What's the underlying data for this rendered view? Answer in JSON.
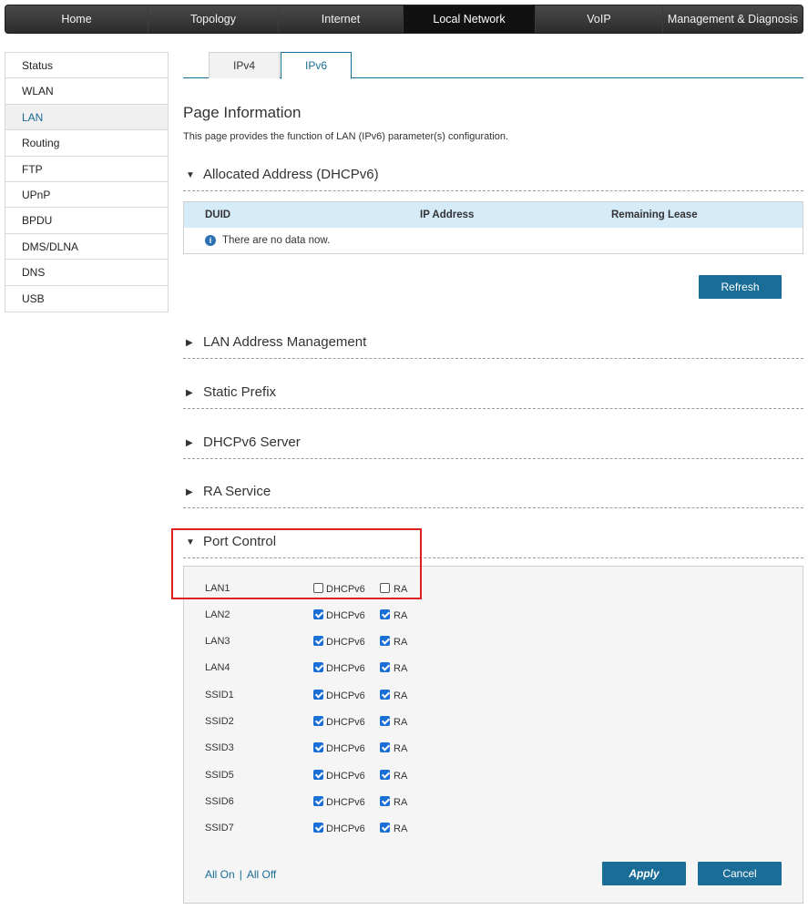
{
  "topnav": {
    "items": [
      {
        "label": "Home"
      },
      {
        "label": "Topology"
      },
      {
        "label": "Internet"
      },
      {
        "label": "Local Network"
      },
      {
        "label": "VoIP"
      },
      {
        "label": "Management & Diagnosis"
      }
    ],
    "active": "Local Network"
  },
  "sidebar": {
    "items": [
      {
        "label": "Status"
      },
      {
        "label": "WLAN"
      },
      {
        "label": "LAN"
      },
      {
        "label": "Routing"
      },
      {
        "label": "FTP"
      },
      {
        "label": "UPnP"
      },
      {
        "label": "BPDU"
      },
      {
        "label": "DMS/DLNA"
      },
      {
        "label": "DNS"
      },
      {
        "label": "USB"
      }
    ],
    "active": "LAN"
  },
  "tabs": [
    {
      "label": "IPv4"
    },
    {
      "label": "IPv6"
    }
  ],
  "active_tab": "IPv6",
  "page": {
    "title": "Page Information",
    "description": "This page provides the function of LAN (IPv6) parameter(s) configuration."
  },
  "sections": {
    "allocated": "Allocated Address (DHCPv6)",
    "lan_addr": "LAN Address Management",
    "static_prefix": "Static Prefix",
    "dhcpv6_server": "DHCPv6 Server",
    "ra_service": "RA Service",
    "port_control": "Port Control"
  },
  "allocated_table": {
    "columns": [
      "DUID",
      "IP Address",
      "Remaining Lease"
    ],
    "empty_message": "There are no data now.",
    "info_icon": "i"
  },
  "buttons": {
    "refresh": "Refresh",
    "apply": "Apply",
    "cancel": "Cancel"
  },
  "port_control": {
    "check_labels": {
      "dhcpv6": "DHCPv6",
      "ra": "RA"
    },
    "ports": [
      {
        "name": "LAN1",
        "dhcpv6": false,
        "ra": false
      },
      {
        "name": "LAN2",
        "dhcpv6": true,
        "ra": true
      },
      {
        "name": "LAN3",
        "dhcpv6": true,
        "ra": true
      },
      {
        "name": "LAN4",
        "dhcpv6": true,
        "ra": true
      },
      {
        "name": "SSID1",
        "dhcpv6": true,
        "ra": true
      },
      {
        "name": "SSID2",
        "dhcpv6": true,
        "ra": true
      },
      {
        "name": "SSID3",
        "dhcpv6": true,
        "ra": true
      },
      {
        "name": "SSID5",
        "dhcpv6": true,
        "ra": true
      },
      {
        "name": "SSID6",
        "dhcpv6": true,
        "ra": true
      },
      {
        "name": "SSID7",
        "dhcpv6": true,
        "ra": true
      }
    ],
    "links": {
      "all_on": "All On",
      "separator": "|",
      "all_off": "All Off"
    }
  },
  "colors": {
    "accent": "#1a6d96",
    "highlight": "#e02020",
    "table_header": "#d6ebf8"
  }
}
